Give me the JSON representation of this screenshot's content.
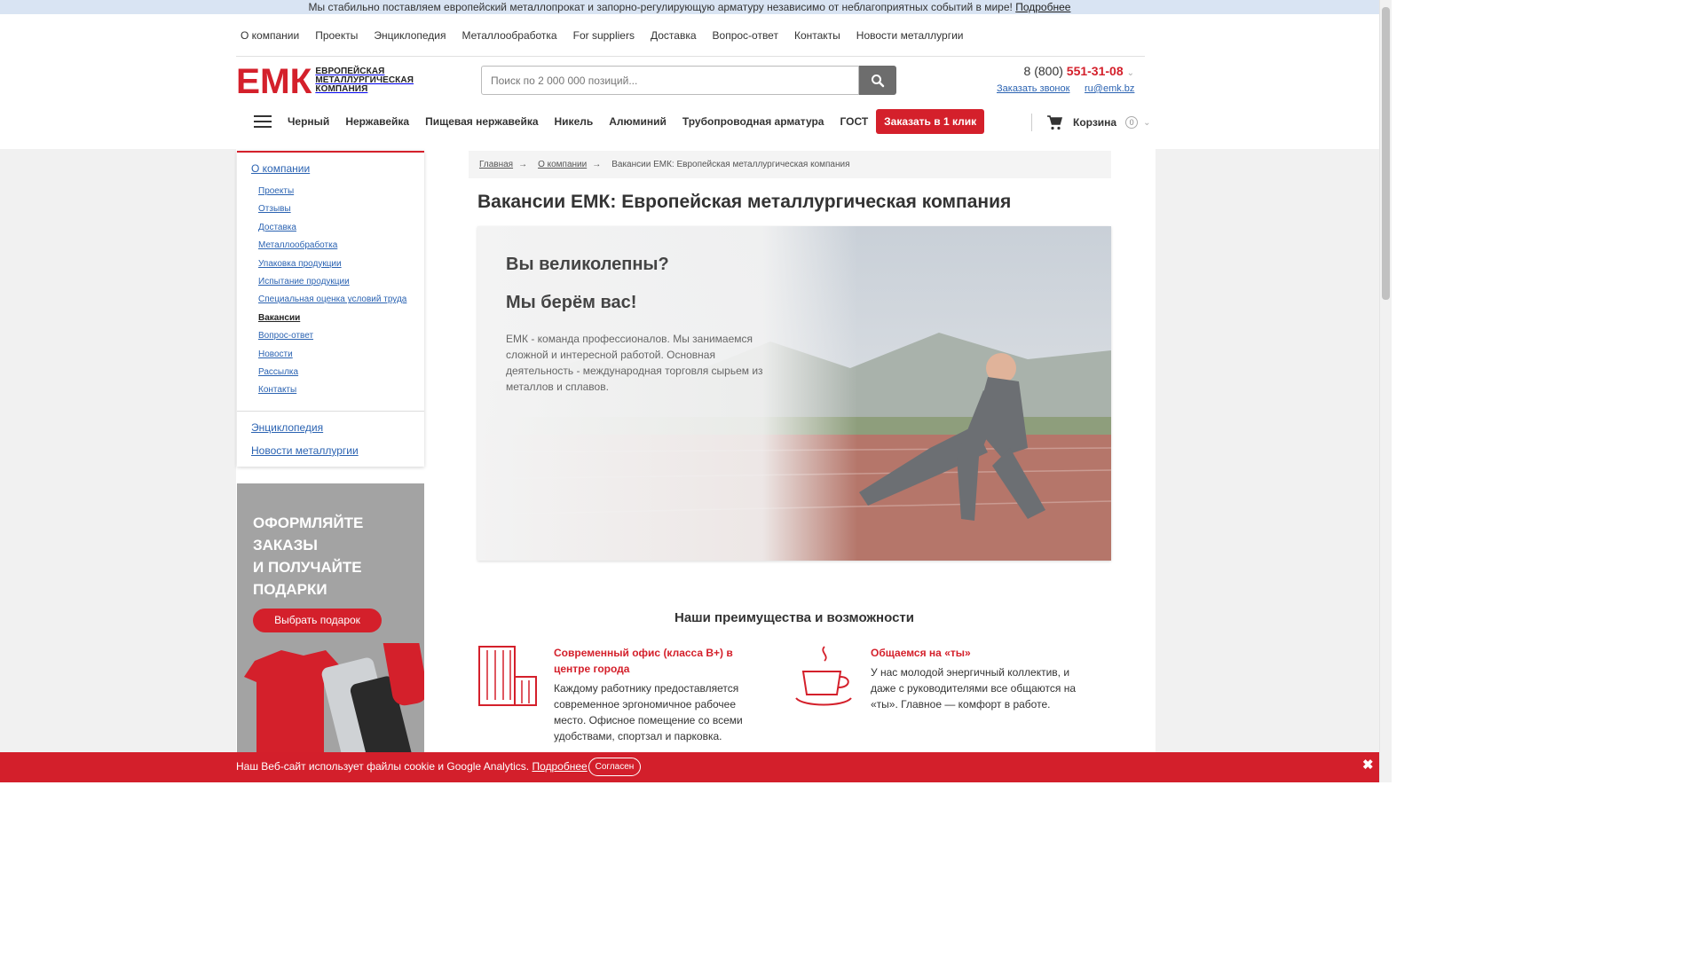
{
  "notice": {
    "text": "Мы стабильно поставляем европейский металлопрокат и запорно-регулирующую арматуру независимо от неблагоприятных событий в мире!",
    "link": "Подробнее"
  },
  "topnav": [
    "О компании",
    "Проекты",
    "Энциклопедия",
    "Металлообработка",
    "For suppliers",
    "Доставка",
    "Вопрос-ответ",
    "Контакты",
    "Новости металлургии"
  ],
  "logo": {
    "mark": "ЕМК",
    "line1": "ЕВРОПЕЙСКАЯ",
    "line2": "МЕТАЛЛУРГИЧЕСКАЯ",
    "line3": "КОМПАНИЯ"
  },
  "search": {
    "placeholder": "Поиск по 2 000 000 позиций..."
  },
  "contacts": {
    "phone_prefix": "8 (800) ",
    "phone_main": "551-31-08",
    "callback": "Заказать звонок",
    "email": "ru@emk.bz"
  },
  "catbar": {
    "items": [
      "Черный",
      "Нержавейка",
      "Пищевая нержавейка",
      "Никель",
      "Алюминий",
      "Трубопроводная арматура",
      "ГОСТ"
    ],
    "order_button": "Заказать в 1 клик"
  },
  "cart": {
    "label": "Корзина",
    "count": "0"
  },
  "sidebar": {
    "title": "О компании",
    "items": [
      "Проекты",
      "Отзывы",
      "Доставка",
      "Металлообработка",
      "Упаковка продукции",
      "Испытание продукции",
      "Специальная оценка условий труда",
      "Вакансии",
      "Вопрос-ответ",
      "Новости",
      "Рассылка",
      "Контакты"
    ],
    "active": "Вакансии",
    "extra": [
      "Энциклопедия",
      "Новости металлургии"
    ]
  },
  "promo": {
    "line1": "ОФОРМЛЯЙТЕ",
    "line2": "ЗАКАЗЫ",
    "line3": "И ПОЛУЧАЙТЕ",
    "line4": "ПОДАРКИ",
    "button": "Выбрать подарок"
  },
  "breadcrumb": {
    "home": "Главная",
    "section": "О компании",
    "arrow": "→",
    "current": "Вакансии ЕМК: Европейская металлургическая компания"
  },
  "page_title": "Вакансии ЕМК: Европейская металлургическая компания",
  "hero": {
    "heading1": "Вы великолепны?",
    "heading2": "Мы берём вас!",
    "text": "ЕМК - команда профессионалов. Мы занимаемся сложной и интересной работой. Основная деятельность - международная торговля сырьем из металлов и сплавов."
  },
  "advantages": {
    "title": "Наши преимущества и возможности",
    "items": [
      {
        "title": "Современный офис (класса В+) в центре города",
        "text": "Каждому работнику предоставляется современное эргономичное рабочее место. Офисное помещение со всеми удобствами, спортзал и парковка.",
        "icon": "building-icon"
      },
      {
        "title": "Общаемся на «ты»",
        "text": "У нас молодой энергичный коллектив, и даже с руководителями все общаются на «ты». Главное — комфорт в работе.",
        "icon": "coffee-cup-icon"
      }
    ]
  },
  "cookie": {
    "text": "Наш Веб-сайт использует файлы cookie и Google Analytics.",
    "link": "Подробнее",
    "button": "Согласен",
    "close": "✖"
  },
  "colors": {
    "accent": "#d4202b",
    "link": "#2b63b2",
    "notice_bg": "#d9e4f3"
  }
}
